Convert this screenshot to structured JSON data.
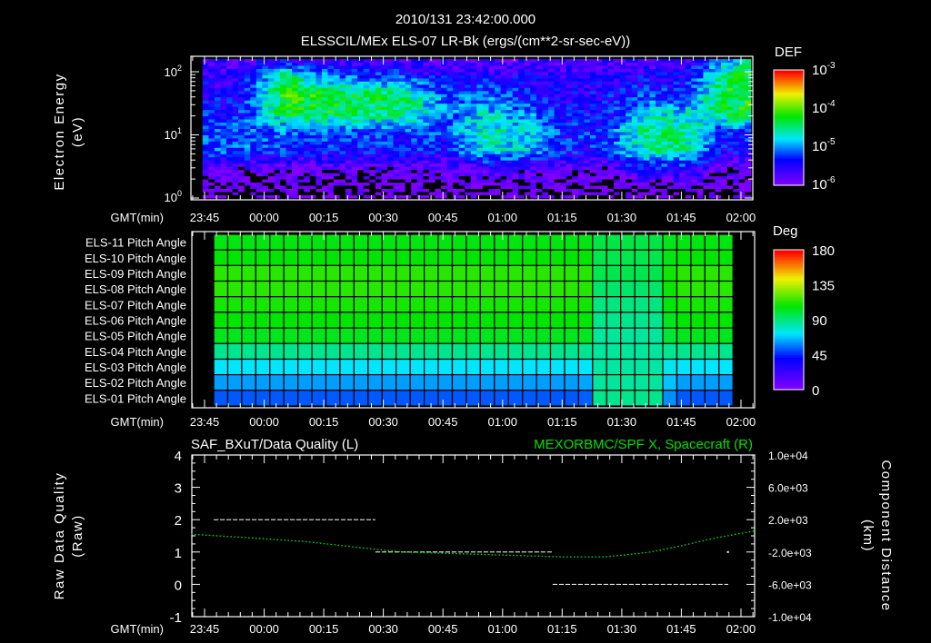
{
  "header": {
    "timestamp": "2010/131 23:42:00.000",
    "title": "ELSSCIL/MEx ELS-07 LR-Bk  (ergs/(cm**2-sr-sec-eV))"
  },
  "time_axis": {
    "label": "GMT(min)",
    "ticks": [
      "23:45",
      "00:00",
      "00:15",
      "00:30",
      "00:45",
      "01:00",
      "01:15",
      "01:30",
      "01:45",
      "02:00"
    ],
    "tick_minutes_from_2345": [
      0,
      15,
      30,
      45,
      60,
      75,
      90,
      105,
      120,
      135
    ],
    "range_minutes_from_2345": [
      -3.4,
      138
    ]
  },
  "colors": {
    "background": "#000000",
    "axes": "#ffffff",
    "right_series": "#00e000"
  },
  "chart_data": [
    {
      "type": "heatmap",
      "name": "spectrogram",
      "title": "ELSSCIL/MEx ELS-07 LR-Bk  (ergs/(cm**2-sr-sec-eV))",
      "ylabel": "Electron Energy",
      "ylabel_units": "(eV)",
      "yscale": "log",
      "ylim": [
        1,
        170
      ],
      "yticks": [
        {
          "base": "10",
          "exp": "0"
        },
        {
          "base": "10",
          "exp": "1"
        },
        {
          "base": "10",
          "exp": "2"
        }
      ],
      "colorbar": {
        "title": "DEF",
        "labels": [
          {
            "base": "10",
            "exp": "-3"
          },
          {
            "base": "10",
            "exp": "-4"
          },
          {
            "base": "10",
            "exp": "-5"
          },
          {
            "base": "10",
            "exp": "-6"
          }
        ],
        "log_range": [
          -6.2,
          -3
        ]
      },
      "x_minutes": [
        -0.5,
        8,
        20,
        30,
        40,
        50,
        60,
        70,
        80,
        90,
        100,
        110,
        120,
        130,
        137
      ],
      "log10_energy": [
        0.15,
        0.45,
        0.75,
        1.05,
        1.35,
        1.65,
        1.95,
        2.15
      ],
      "log10_def": [
        [
          -6.3,
          -6.3,
          -6.3,
          -6.3,
          -6.3,
          -6.3,
          -6.3,
          -6.3,
          -6.3,
          -6.3,
          -6.3,
          -6.3,
          -6.3,
          -6.3,
          -6.3
        ],
        [
          -6.1,
          -6.1,
          -6.1,
          -6.1,
          -6.1,
          -6.1,
          -6.1,
          -6.0,
          -6.0,
          -6.1,
          -6.1,
          -5.6,
          -5.7,
          -6.1,
          -6.1
        ],
        [
          -5.3,
          -5.3,
          -5.4,
          -5.5,
          -5.5,
          -5.5,
          -5.6,
          -4.8,
          -5.0,
          -5.5,
          -5.5,
          -4.7,
          -4.7,
          -5.6,
          -5.6
        ],
        [
          -5.3,
          -5.3,
          -5.3,
          -5.4,
          -5.4,
          -5.3,
          -5.4,
          -4.7,
          -4.9,
          -5.5,
          -5.4,
          -4.6,
          -4.6,
          -5.5,
          -5.4
        ],
        [
          -5.5,
          -5.5,
          -4.4,
          -4.4,
          -4.5,
          -4.6,
          -5.2,
          -4.9,
          -5.2,
          -5.6,
          -5.6,
          -4.9,
          -4.9,
          -4.5,
          -4.3
        ],
        [
          -5.6,
          -5.7,
          -4.2,
          -4.4,
          -4.5,
          -4.6,
          -5.3,
          -5.3,
          -5.5,
          -5.7,
          -5.6,
          -5.4,
          -5.5,
          -4.4,
          -4.3
        ],
        [
          -5.8,
          -5.8,
          -4.5,
          -5.2,
          -5.4,
          -5.5,
          -5.7,
          -5.7,
          -5.7,
          -5.8,
          -5.8,
          -5.7,
          -5.7,
          -4.5,
          -4.4
        ],
        [
          -5.9,
          -5.9,
          -5.6,
          -5.8,
          -5.8,
          -5.8,
          -5.9,
          -5.9,
          -5.9,
          -5.9,
          -5.9,
          -5.9,
          -5.9,
          -5.0,
          -4.8
        ]
      ]
    },
    {
      "type": "heatmap",
      "name": "pitch-angle",
      "colorbar": {
        "title": "Deg",
        "labels": [
          "180",
          "135",
          "90",
          "45",
          "0"
        ],
        "range": [
          0,
          180
        ]
      },
      "time_range_minutes": [
        2.3,
        133
      ],
      "bin_minutes": 3.54,
      "disturbed_window_minutes": [
        96,
        118
      ],
      "rows": [
        {
          "label": "ELS-11 Pitch Angle",
          "baseline_deg": 106,
          "window_deg": 98
        },
        {
          "label": "ELS-10 Pitch Angle",
          "baseline_deg": 108,
          "window_deg": 97
        },
        {
          "label": "ELS-09 Pitch Angle",
          "baseline_deg": 114,
          "window_deg": 97
        },
        {
          "label": "ELS-08 Pitch Angle",
          "baseline_deg": 114,
          "window_deg": 93
        },
        {
          "label": "ELS-07 Pitch Angle",
          "baseline_deg": 111,
          "window_deg": 90
        },
        {
          "label": "ELS-06 Pitch Angle",
          "baseline_deg": 108,
          "window_deg": 88
        },
        {
          "label": "ELS-05 Pitch Angle",
          "baseline_deg": 104,
          "window_deg": 86
        },
        {
          "label": "ELS-04 Pitch Angle",
          "baseline_deg": 88,
          "window_deg": 86
        },
        {
          "label": "ELS-03 Pitch Angle",
          "baseline_deg": 72,
          "window_deg": 85
        },
        {
          "label": "ELS-02 Pitch Angle",
          "baseline_deg": 62,
          "window_deg": 86
        },
        {
          "label": "ELS-01 Pitch Angle",
          "baseline_deg": 52,
          "window_deg": 88
        }
      ]
    },
    {
      "type": "line",
      "name": "data-quality-and-position",
      "left_title": "SAF_BXuT/Data Quality (L)",
      "right_title": "MEXORBMC/SPF X, Spacecraft (R)",
      "ylabel_left": "Raw Data Quality",
      "ylabel_left_units": "(Raw)",
      "ylabel_right": "Component Distance",
      "ylabel_right_units": "(km)",
      "ylim_left": [
        -1,
        4
      ],
      "yticks_left": [
        "4",
        "3",
        "2",
        "1",
        "0",
        "-1"
      ],
      "ylim_right": [
        -10000,
        10000
      ],
      "yticks_right": [
        "1.0e+04",
        "6.0e+03",
        "2.0e+03",
        "-2.0e+03",
        "-6.0e+03",
        "-1.0e+04"
      ],
      "quality_segments": [
        {
          "start_min": 2.3,
          "end_min": 43,
          "value": 2
        },
        {
          "start_min": 43,
          "end_min": 87.6,
          "value": 1
        },
        {
          "start_min": 87.6,
          "end_min": 131.8,
          "value": 0
        }
      ],
      "quality_points": [
        {
          "min": 131.5,
          "value": 1
        }
      ],
      "spf_x_km": {
        "minutes": [
          -3.4,
          10,
          25,
          40,
          50,
          60,
          70,
          80,
          90,
          100,
          105,
          112,
          120,
          128,
          138
        ],
        "values": [
          200,
          -200,
          -700,
          -1500,
          -2000,
          -2150,
          -2300,
          -2450,
          -2600,
          -2600,
          -2400,
          -2000,
          -1200,
          -300,
          600
        ]
      }
    }
  ]
}
